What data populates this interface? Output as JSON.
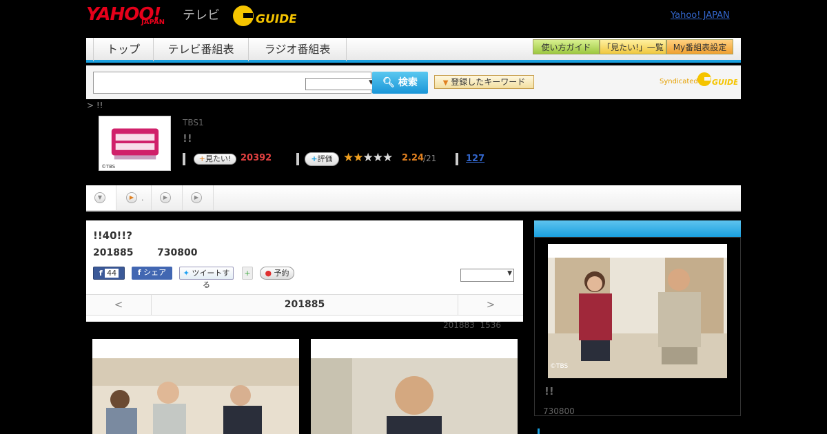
{
  "header": {
    "yahoo_logo": "YAHOO!",
    "japan_logo": "JAPAN",
    "tv_label": "テレビ",
    "gguide_logo": "G GUIDE",
    "yahoo_japan_link": "Yahoo! JAPAN"
  },
  "nav": {
    "tabs": [
      "トップ",
      "テレビ番組表",
      "ラジオ番組表"
    ],
    "buttons": [
      "使い方ガイド",
      "「見たい!」一覧",
      "My番組表設定"
    ]
  },
  "search": {
    "input_value": "",
    "select_value": "",
    "button_label": "検索",
    "keyword_button": "登録したキーワード",
    "syndicated_label": "Syndicated",
    "syndicated_logo": "G GUIDE"
  },
  "breadcrumb": "> !!",
  "program": {
    "channel": "TBS1",
    "title": "!!",
    "image_copyright": "©TBS",
    "mitai_label": "見たい!",
    "mitai_count": "20392",
    "hyouka_label": "評価",
    "rating_score": "2.24",
    "rating_total": "/21",
    "rating_stars": 2,
    "review_count": "127"
  },
  "episode": {
    "title": "!!40!!?",
    "date": "201885",
    "time": "730800",
    "fb_like_count": "44",
    "share_label": "シェア",
    "tweet_label": "ツイートする",
    "reserve_label": "予約",
    "select_value": "",
    "pager_prev": "<",
    "pager_current": "201885",
    "pager_next": ">",
    "updated": "201883  1536"
  },
  "sidebar": {
    "photo_copyright": "©TBS",
    "title": "!!",
    "meta": "730800"
  },
  "colors": {
    "accent_blue": "#1aa0df",
    "brand_red": "#e6001a",
    "gguide_yellow": "#f5c400"
  }
}
